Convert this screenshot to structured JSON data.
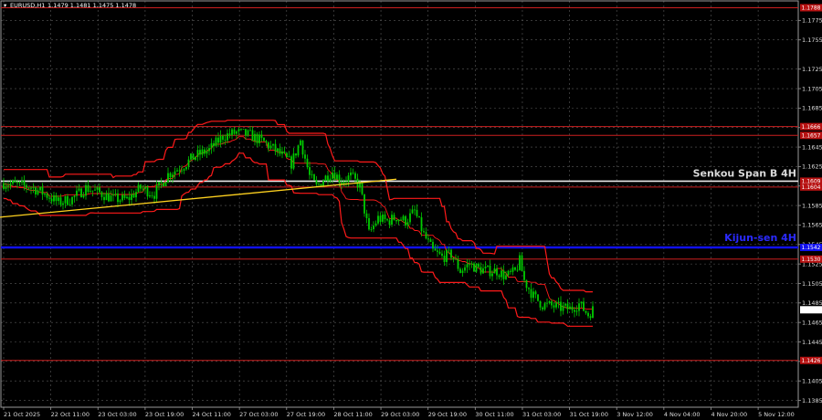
{
  "header": {
    "symbol": "EURUSD,H1",
    "ohlc": "1.1479 1.1481 1.1475 1.1478"
  },
  "colors": {
    "background": "#000000",
    "grid": "#5a5a5a",
    "candle": "#00cc00",
    "ichimoku": "#ff1a1a",
    "level_line": "#cc1f1f",
    "senkou_line": "#e8e8e8",
    "kijun_line": "#1010ee",
    "trendline": "#ffd21f",
    "axis_text": "#dcdcdc",
    "price_tag_bg": "#b71111",
    "current_tag_bg": "#ffffff"
  },
  "chart_data": {
    "type": "candlestick",
    "ylim": [
      1.1378,
      1.1795
    ],
    "y_ticks": [
      "1.1775",
      "1.1755",
      "1.1725",
      "1.1705",
      "1.1685",
      "1.1665",
      "1.1645",
      "1.1625",
      "1.1605",
      "1.1585",
      "1.1565",
      "1.1545",
      "1.1525",
      "1.1505",
      "1.1485",
      "1.1465",
      "1.1445",
      "1.1425",
      "1.1405",
      "1.1385"
    ],
    "x_labels": [
      "21 Oct 2025",
      "22 Oct 11:00",
      "23 Oct 03:00",
      "23 Oct 19:00",
      "24 Oct 11:00",
      "27 Oct 03:00",
      "27 Oct 19:00",
      "28 Oct 11:00",
      "29 Oct 03:00",
      "29 Oct 19:00",
      "30 Oct 11:00",
      "31 Oct 03:00",
      "31 Oct 19:00",
      "3 Nov 12:00",
      "4 Nov 04:00",
      "4 Nov 20:00",
      "5 Nov 12:00"
    ],
    "price_levels": [
      {
        "value": 1.1788,
        "label": "1.1788"
      },
      {
        "value": 1.1666,
        "label": "1.1666"
      },
      {
        "value": 1.1657,
        "label": "1.1657"
      },
      {
        "value": 1.1604,
        "label": "1.1604"
      },
      {
        "value": 1.153,
        "label": "1.1530"
      },
      {
        "value": 1.1426,
        "label": "1.1426"
      }
    ],
    "senkou_span_b": {
      "value": 1.161,
      "label": "Senkou Span B 4H",
      "tag": "1.1609"
    },
    "kijun_sen": {
      "value": 1.1542,
      "label": "Kijun-sen 4H",
      "tag": "1.1542"
    },
    "current_price": {
      "value": 1.1478,
      "label": "1.1478"
    },
    "trendline": {
      "from": {
        "x": 0,
        "y": 1.1573
      },
      "to": {
        "x": 172,
        "y": 1.1612
      }
    },
    "close_path": [
      [
        0,
        1.1608
      ],
      [
        6,
        1.1606
      ],
      [
        12,
        1.1604
      ],
      [
        18,
        1.1597
      ],
      [
        24,
        1.1588
      ],
      [
        30,
        1.1592
      ],
      [
        36,
        1.1603
      ],
      [
        42,
        1.1598
      ],
      [
        48,
        1.1592
      ],
      [
        54,
        1.1591
      ],
      [
        60,
        1.1603
      ],
      [
        66,
        1.1597
      ],
      [
        72,
        1.1617
      ],
      [
        78,
        1.1625
      ],
      [
        84,
        1.1636
      ],
      [
        90,
        1.1642
      ],
      [
        96,
        1.1656
      ],
      [
        102,
        1.166
      ],
      [
        108,
        1.1657
      ],
      [
        114,
        1.165
      ],
      [
        120,
        1.164
      ],
      [
        126,
        1.1628
      ],
      [
        130,
        1.1652
      ],
      [
        134,
        1.1615
      ],
      [
        137,
        1.1604
      ],
      [
        140,
        1.1612
      ],
      [
        144,
        1.162
      ],
      [
        148,
        1.161
      ],
      [
        152,
        1.1615
      ],
      [
        156,
        1.1605
      ],
      [
        160,
        1.1556
      ],
      [
        164,
        1.1572
      ],
      [
        168,
        1.1569
      ],
      [
        172,
        1.1573
      ],
      [
        176,
        1.1569
      ],
      [
        180,
        1.1579
      ],
      [
        184,
        1.1555
      ],
      [
        188,
        1.1538
      ],
      [
        192,
        1.1532
      ],
      [
        196,
        1.1535
      ],
      [
        200,
        1.1518
      ],
      [
        204,
        1.1525
      ],
      [
        208,
        1.152
      ],
      [
        212,
        1.1518
      ],
      [
        216,
        1.1518
      ],
      [
        220,
        1.1512
      ],
      [
        224,
        1.1517
      ],
      [
        226,
        1.1528
      ],
      [
        228,
        1.1508
      ],
      [
        232,
        1.1492
      ],
      [
        236,
        1.1483
      ],
      [
        240,
        1.1482
      ],
      [
        244,
        1.148
      ],
      [
        248,
        1.1479
      ],
      [
        252,
        1.1484
      ],
      [
        256,
        1.1473
      ],
      [
        258,
        1.1478
      ]
    ]
  }
}
